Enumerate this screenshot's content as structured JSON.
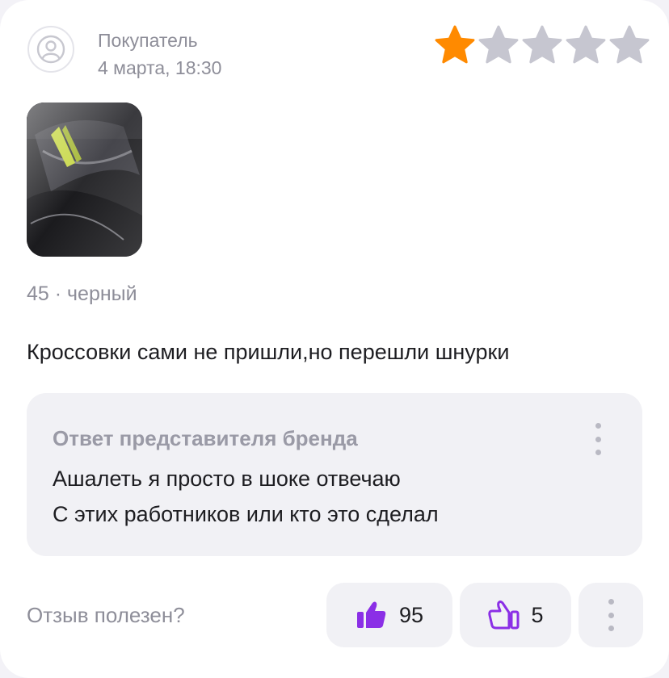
{
  "review": {
    "author": "Покупатель",
    "date": "4 марта, 18:30",
    "rating": 1,
    "max_rating": 5,
    "variant": "45 · черный",
    "text": "Кроссовки сами не пришли,но перешли шнурки"
  },
  "reply": {
    "title": "Ответ представителя бренда",
    "lines": [
      "Ашалеть я просто в шоке отвечаю",
      "С этих работников или кто это сделал"
    ]
  },
  "feedback": {
    "question": "Отзыв полезен?",
    "likes": "95",
    "dislikes": "5"
  },
  "colors": {
    "star_active": "#ff8a00",
    "star_inactive": "#c6c6d0",
    "accent": "#8b2fe6"
  },
  "icons": {
    "avatar": "user-icon",
    "like": "thumbs-up-icon",
    "dislike": "thumbs-down-icon",
    "more": "more-vertical-icon"
  }
}
